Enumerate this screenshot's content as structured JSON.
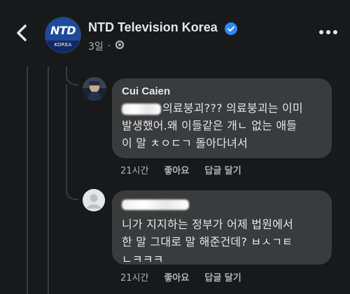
{
  "header": {
    "page_name": "NTD Television Korea",
    "logo_text": "NTD",
    "logo_subtext": "KOREA",
    "timestamp": "3일",
    "separator": "·",
    "verified_icon": "verified-badge-icon",
    "privacy_icon": "public-globe-icon",
    "more_icon": "more-options-icon",
    "back_icon": "back-arrow-icon"
  },
  "comments": [
    {
      "author": "Cui Caien",
      "mention_redacted": true,
      "text_line1": "의료붕괴??? 의료붕괴는 이미",
      "text_line2": "발생했어.왜 이들같은 개ㄴ 없는 애들",
      "text_line3": "이 말 ㅊㅇㄷㄱ 돌아다녀서",
      "time": "21시간",
      "like_label": "좋아요",
      "reply_label": "답글 달기"
    },
    {
      "author_redacted": true,
      "text_line1": "니가 지지하는 정부가 어제 법원에서",
      "text_line2": "한 말 그대로 말 해준건데? ㅂㅅㄱㅌ",
      "text_line3": "ㄴㅋㅋㅋ",
      "time": "21시간",
      "like_label": "좋아요",
      "reply_label": "답글 달기"
    }
  ],
  "colors": {
    "background": "#18191a",
    "bubble": "#3a3b3c",
    "text": "#e4e6eb",
    "muted": "#b0b3b8",
    "verified": "#2d88ff",
    "thread_line": "#3a3b3c"
  }
}
